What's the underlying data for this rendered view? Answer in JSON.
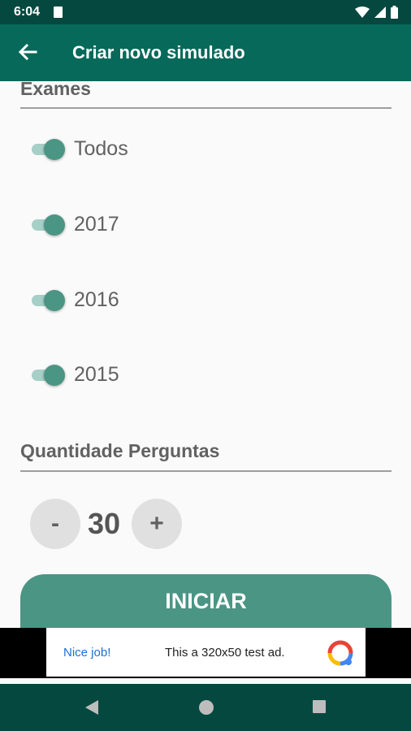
{
  "status_bar": {
    "time": "6:04",
    "icons": [
      "sd-card-icon",
      "wifi-icon",
      "signal-icon",
      "battery-icon"
    ]
  },
  "app_bar": {
    "title": "Criar novo simulado",
    "back_icon": "arrow-left-icon"
  },
  "exams": {
    "section_title": "Exames",
    "options": [
      {
        "label": "Todos",
        "checked": true
      },
      {
        "label": "2017",
        "checked": true
      },
      {
        "label": "2016",
        "checked": true
      },
      {
        "label": "2015",
        "checked": true
      }
    ]
  },
  "questions": {
    "section_title": "Quantidade Perguntas",
    "minus_label": "-",
    "plus_label": "+",
    "value": "30"
  },
  "start_button": {
    "label": "INICIAR"
  },
  "ad": {
    "left_text": "Nice job!",
    "main_text": "This a 320x50 test ad."
  },
  "colors": {
    "status_bar": "#05483f",
    "app_bar": "#06695a",
    "accent": "#4b9584",
    "toggle_track": "#a6cfc7"
  }
}
